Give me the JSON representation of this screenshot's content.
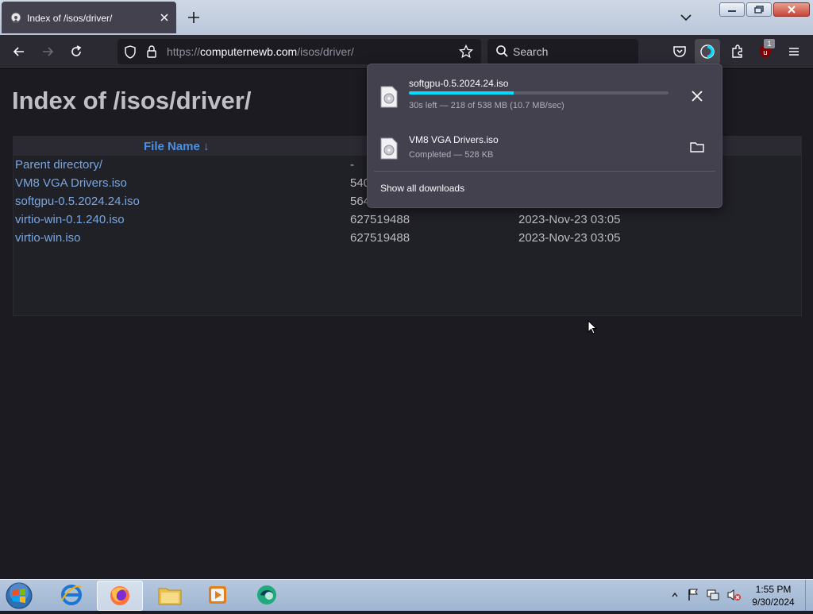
{
  "browser": {
    "tab": {
      "title": "Index of /isos/driver/"
    },
    "url": {
      "scheme": "https://",
      "host": "computernewb.com",
      "path": "/isos/driver/"
    },
    "search": {
      "placeholder": "Search"
    },
    "extension_badge": "1"
  },
  "page": {
    "heading": "Index of /isos/driver/",
    "table": {
      "header": {
        "file_name": "File Name  ↓"
      },
      "rows": [
        {
          "name": "Parent directory/",
          "size": "-",
          "date": ""
        },
        {
          "name": "VM8 VGA Drivers.iso",
          "size": "540",
          "date": ""
        },
        {
          "name": "softgpu-0.5.2024.24.iso",
          "size": "564",
          "date": ""
        },
        {
          "name": "virtio-win-0.1.240.iso",
          "size": "627519488",
          "date": "2023-Nov-23 03:05"
        },
        {
          "name": "virtio-win.iso",
          "size": "627519488",
          "date": "2023-Nov-23 03:05"
        }
      ]
    }
  },
  "downloads_panel": {
    "items": [
      {
        "name": "softgpu-0.5.2024.24.iso",
        "status": "30s left — 218 of 538 MB (10.7 MB/sec)",
        "progress": 0.405
      },
      {
        "name": "VM8 VGA Drivers.iso",
        "status": "Completed — 528 KB"
      }
    ],
    "show_all": "Show all downloads"
  },
  "taskbar": {
    "clock": {
      "time": "1:55 PM",
      "date": "9/30/2024"
    }
  },
  "colors": {
    "accent": "#00ddff",
    "link": "#4a90e2",
    "page_bg": "#1c1b22"
  }
}
